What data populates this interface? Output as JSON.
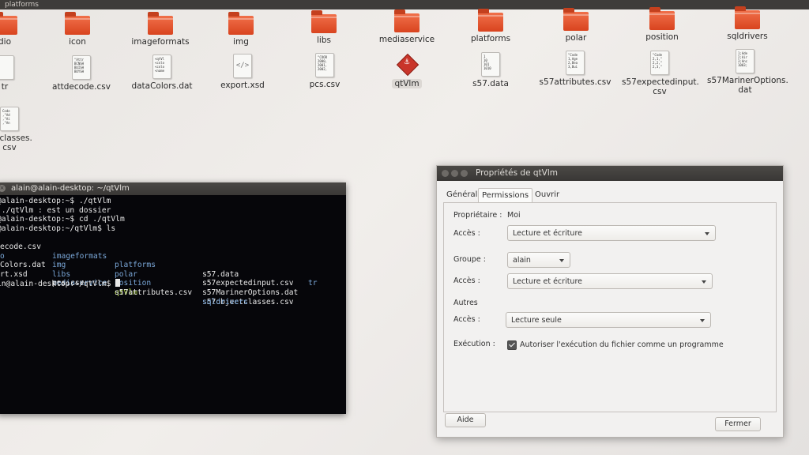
{
  "desktop": {
    "window_title": "platforms",
    "row1": [
      "dio",
      "icon",
      "imageformats",
      "img",
      "libs",
      "mediaservice",
      "platforms",
      "polar",
      "position",
      "sqldrivers"
    ],
    "row2": [
      "tr",
      "attdecode.csv",
      "dataColors.dat",
      "export.xsd",
      "pcs.csv",
      "qtVlm",
      "s57.data",
      "s57attributes.csv",
      "s57expectedinput.\ncsv",
      "s57MarinerOptions.\ndat"
    ],
    "row3": [
      "ectclasses.\ncsv"
    ],
    "doc_previews": {
      "attdecode": "\"Attr\nBCNSH\nBUISH\nBOYSH",
      "dataColors": "<qtVl\n<colo\n<colo\n<name",
      "pcs": "\"COOR\n2000,\n2001,\n2002,",
      "s57data": "1\n10\n101\n1010",
      "s57attributes": "\"Code\n1,Age\n2,Bea\n3,Bui",
      "s57expected": "\"Code\n2,1,\"\n2,2,\"\n2,3,\"",
      "s57mariner": "1;Ade\n2;Air\n3;Anc\n1003;",
      "objectclasses": "Code\n,\"Ad\n,\"Ai\n,\"An"
    }
  },
  "terminal": {
    "title": "alain@alain-desktop: ~/qtVlm",
    "lines": [
      "@alain-desktop:~$ ./qtVlm",
      " ./qtVlm : est un dossier",
      "@alain-desktop:~$ cd ./qtVlm",
      "@alain-desktop:~/qtVlm$ ls"
    ],
    "ls": [
      [
        "ecode.csv",
        "imageformats",
        "platforms",
        "s57.data",
        "tr"
      ],
      [
        "o",
        "img",
        "polar",
        "s57expectedinput.csv",
        ""
      ],
      [
        "Colors.dat",
        "libs",
        "position",
        "s57MarinerOptions.dat",
        ""
      ],
      [
        "rt.xsd",
        "mediaservice",
        "qtVlm",
        "s57objectclasses.csv",
        ""
      ],
      [
        "",
        "pcs.csv",
        "s57attributes.csv",
        "sqldrivers",
        ""
      ]
    ],
    "prompt": "in@alain-desktop:~/qtVlm$ "
  },
  "dialog": {
    "title": "Propriétés de qtVlm",
    "tabs": [
      "Général",
      "Permissions",
      "Ouvrir avec"
    ],
    "owner_label": "Propriétaire :",
    "owner_value": "Moi",
    "access_label": "Accès :",
    "owner_access": "Lecture et écriture",
    "group_label": "Groupe :",
    "group_value": "alain",
    "group_access": "Lecture et écriture",
    "others_label": "Autres",
    "others_access": "Lecture seule",
    "exec_label": "Exécution :",
    "exec_checkbox": "Autoriser l'exécution du fichier comme un programme",
    "help": "Aide",
    "close": "Fermer"
  },
  "colors": {
    "terminal_bg": "#06060a",
    "folder": "#e05a32",
    "dir_text": "#7aa7d8",
    "exec_text": "#b8e04a"
  }
}
